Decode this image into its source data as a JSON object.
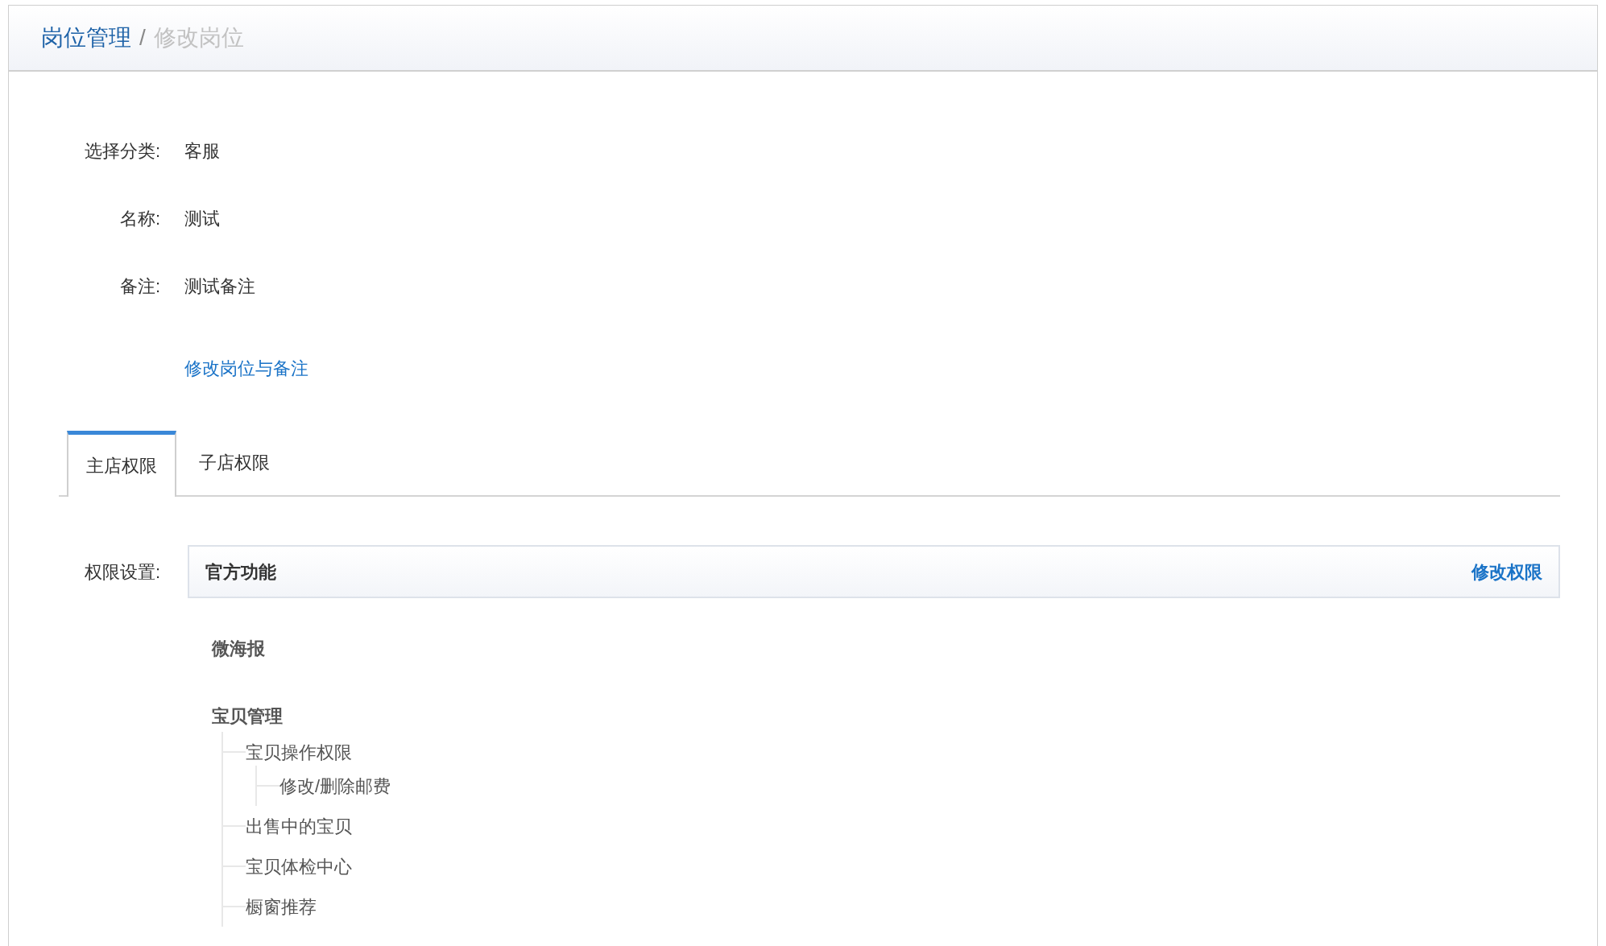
{
  "breadcrumb": {
    "parent": "岗位管理",
    "separator": "/",
    "current": "修改岗位"
  },
  "fields": [
    {
      "label": "选择分类:",
      "value": "客服"
    },
    {
      "label": "名称:",
      "value": "测试"
    },
    {
      "label": "备注:",
      "value": "测试备注"
    }
  ],
  "edit_link": "修改岗位与备注",
  "tabs": [
    {
      "label": "主店权限",
      "selected": true
    },
    {
      "label": "子店权限",
      "selected": false
    }
  ],
  "permissions": {
    "label": "权限设置:",
    "group_title": "官方功能",
    "edit_link": "修改权限",
    "tree": [
      {
        "label": "微海报"
      },
      {
        "label": "宝贝管理",
        "children": [
          {
            "label": "宝贝操作权限",
            "children": [
              {
                "label": "修改/删除邮费"
              }
            ]
          },
          {
            "label": "出售中的宝贝"
          },
          {
            "label": "宝贝体检中心"
          },
          {
            "label": "橱窗推荐"
          }
        ]
      }
    ]
  }
}
